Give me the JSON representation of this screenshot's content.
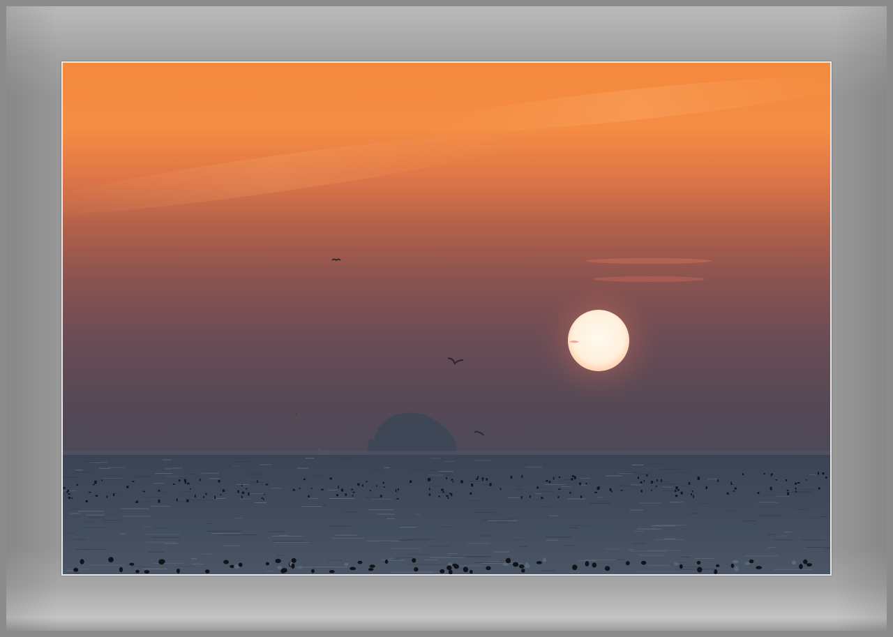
{
  "image": {
    "subject": "sunset-over-sea",
    "elements": [
      "sun",
      "island-silhouette",
      "birds",
      "buoys",
      "sea",
      "sky"
    ]
  },
  "colors": {
    "sky_top": "#f28a3e",
    "sky_mid": "#a45a45",
    "sky_low": "#5f4a52",
    "sea": "#3d4656",
    "sun": "#fff3d8",
    "island": "#3e4656",
    "frame": "#979797",
    "mat_border": "#e8e8e8"
  }
}
